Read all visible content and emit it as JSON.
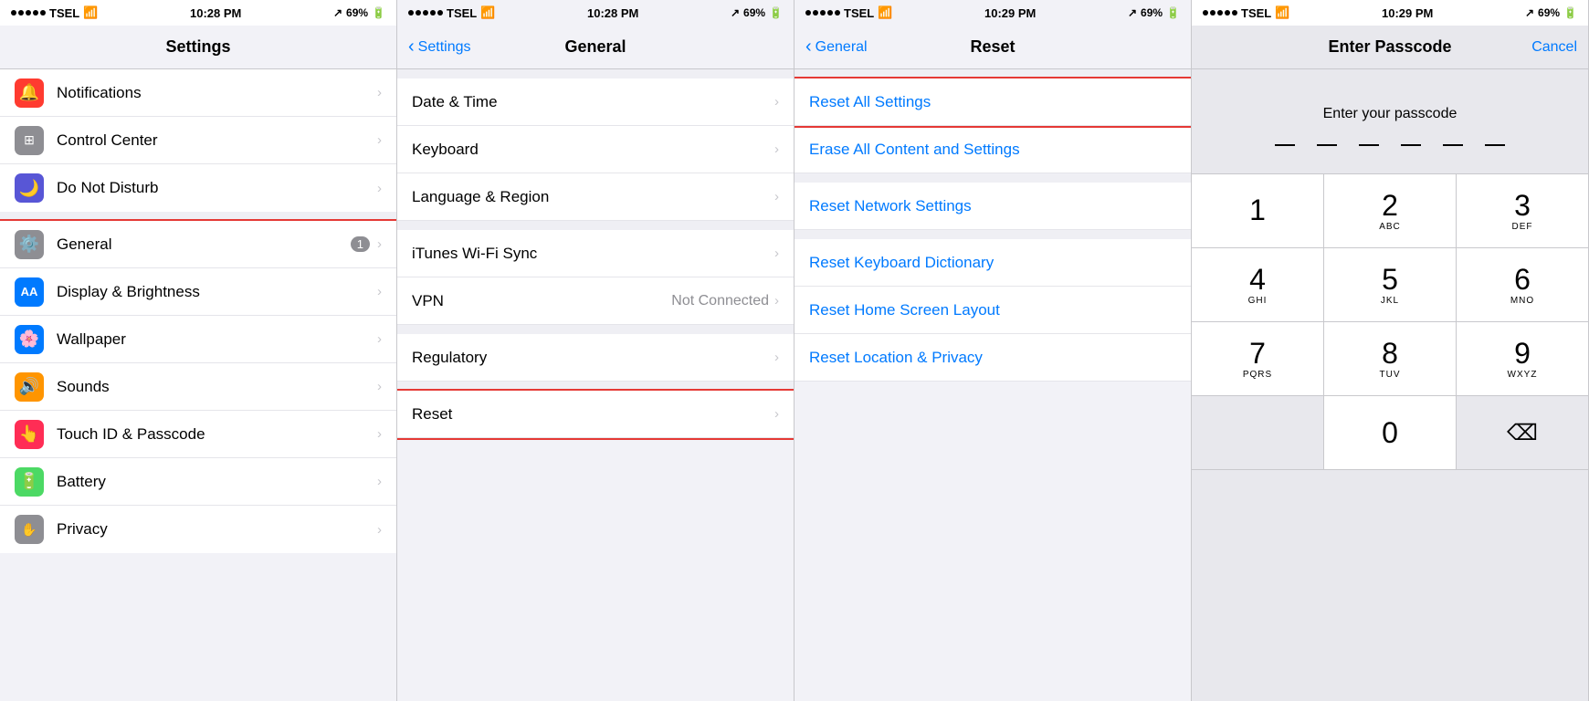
{
  "panels": [
    {
      "id": "panel1",
      "status": {
        "carrier": "TSEL",
        "time": "10:28 PM",
        "battery": "69%"
      },
      "nav": {
        "title": "Settings",
        "back": null
      },
      "groups": [
        {
          "items": [
            {
              "icon": "bell",
              "iconBg": "bg-red",
              "label": "Notifications",
              "chevron": true,
              "highlighted": false
            },
            {
              "icon": "cc",
              "iconBg": "bg-gray",
              "label": "Control Center",
              "chevron": true,
              "highlighted": false
            },
            {
              "icon": "moon",
              "iconBg": "bg-purple",
              "label": "Do Not Disturb",
              "chevron": true,
              "highlighted": false
            }
          ]
        },
        {
          "items": [
            {
              "icon": "gear",
              "iconBg": "bg-gray",
              "label": "General",
              "badge": "1",
              "chevron": true,
              "highlighted": true
            },
            {
              "icon": "AA",
              "iconBg": "bg-aa",
              "label": "Display & Brightness",
              "chevron": true,
              "highlighted": false
            },
            {
              "icon": "wallpaper",
              "iconBg": "bg-blue",
              "label": "Wallpaper",
              "chevron": true,
              "highlighted": false
            },
            {
              "icon": "sound",
              "iconBg": "bg-orange",
              "label": "Sounds",
              "chevron": true,
              "highlighted": false
            },
            {
              "icon": "touch",
              "iconBg": "bg-pink",
              "label": "Touch ID & Passcode",
              "chevron": true,
              "highlighted": false
            },
            {
              "icon": "battery",
              "iconBg": "bg-green",
              "label": "Battery",
              "chevron": true,
              "highlighted": false
            },
            {
              "icon": "privacy",
              "iconBg": "bg-gray",
              "label": "Privacy",
              "chevron": true,
              "highlighted": false
            }
          ]
        }
      ]
    },
    {
      "id": "panel2",
      "status": {
        "carrier": "TSEL",
        "time": "10:28 PM",
        "battery": "69%"
      },
      "nav": {
        "title": "General",
        "back": "Settings"
      },
      "groups": [
        {
          "items": [
            {
              "label": "Date & Time",
              "chevron": true,
              "value": null
            },
            {
              "label": "Keyboard",
              "chevron": true,
              "value": null
            },
            {
              "label": "Language & Region",
              "chevron": true,
              "value": null
            }
          ]
        },
        {
          "items": [
            {
              "label": "iTunes Wi-Fi Sync",
              "chevron": true,
              "value": null
            },
            {
              "label": "VPN",
              "chevron": true,
              "value": "Not Connected"
            }
          ]
        },
        {
          "items": [
            {
              "label": "Regulatory",
              "chevron": true,
              "value": null
            }
          ]
        },
        {
          "items": [
            {
              "label": "Reset",
              "chevron": true,
              "value": null,
              "highlighted": true
            }
          ]
        }
      ]
    },
    {
      "id": "panel3",
      "status": {
        "carrier": "TSEL",
        "time": "10:29 PM",
        "battery": "69%"
      },
      "nav": {
        "title": "Reset",
        "back": "General"
      },
      "groups": [
        {
          "items": [
            {
              "label": "Reset All Settings",
              "highlighted": true
            },
            {
              "label": "Erase All Content and Settings",
              "highlighted": false
            }
          ]
        },
        {
          "items": [
            {
              "label": "Reset Network Settings",
              "highlighted": false
            }
          ]
        },
        {
          "items": [
            {
              "label": "Reset Keyboard Dictionary",
              "highlighted": false
            },
            {
              "label": "Reset Home Screen Layout",
              "highlighted": false
            },
            {
              "label": "Reset Location & Privacy",
              "highlighted": false
            }
          ]
        }
      ]
    },
    {
      "id": "panel4",
      "status": {
        "carrier": "TSEL",
        "time": "10:29 PM",
        "battery": "69%"
      },
      "nav": {
        "title": "Enter Passcode",
        "cancel": "Cancel"
      },
      "passcode": {
        "hint": "Enter your passcode",
        "dots": 6
      },
      "numpad": [
        [
          {
            "number": "1",
            "letters": ""
          },
          {
            "number": "2",
            "letters": "ABC"
          },
          {
            "number": "3",
            "letters": "DEF"
          }
        ],
        [
          {
            "number": "4",
            "letters": "GHI"
          },
          {
            "number": "5",
            "letters": "JKL"
          },
          {
            "number": "6",
            "letters": "MNO"
          }
        ],
        [
          {
            "number": "7",
            "letters": "PQRS"
          },
          {
            "number": "8",
            "letters": "TUV"
          },
          {
            "number": "9",
            "letters": "WXYZ"
          }
        ],
        [
          {
            "number": "",
            "letters": "",
            "type": "empty"
          },
          {
            "number": "0",
            "letters": ""
          },
          {
            "number": "⌫",
            "letters": "",
            "type": "delete"
          }
        ]
      ]
    }
  ]
}
